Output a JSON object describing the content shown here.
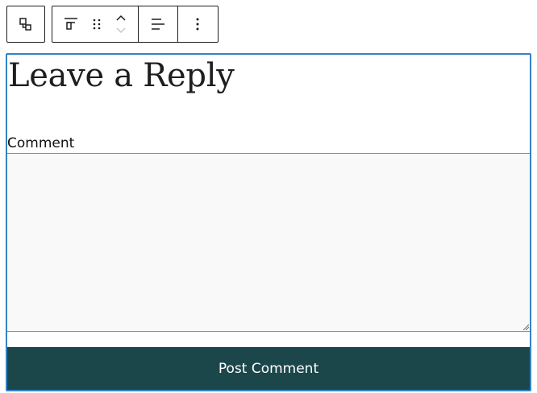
{
  "toolbar": {
    "parent": {
      "icon": "select-parent-icon"
    },
    "items": [
      {
        "icon": "align-top-icon"
      },
      {
        "icon": "drag-handle-icon"
      },
      {
        "icon": "move-up-icon"
      },
      {
        "icon": "move-down-icon"
      },
      {
        "icon": "text-align-left-icon"
      },
      {
        "icon": "more-options-icon"
      }
    ]
  },
  "block": {
    "title": "Leave a Reply",
    "comment_label": "Comment",
    "comment_value": "",
    "submit_label": "Post Comment"
  },
  "colors": {
    "selection_outline": "#3582c4",
    "submit_background": "#1b474b",
    "textarea_background": "#f9f9f9"
  }
}
